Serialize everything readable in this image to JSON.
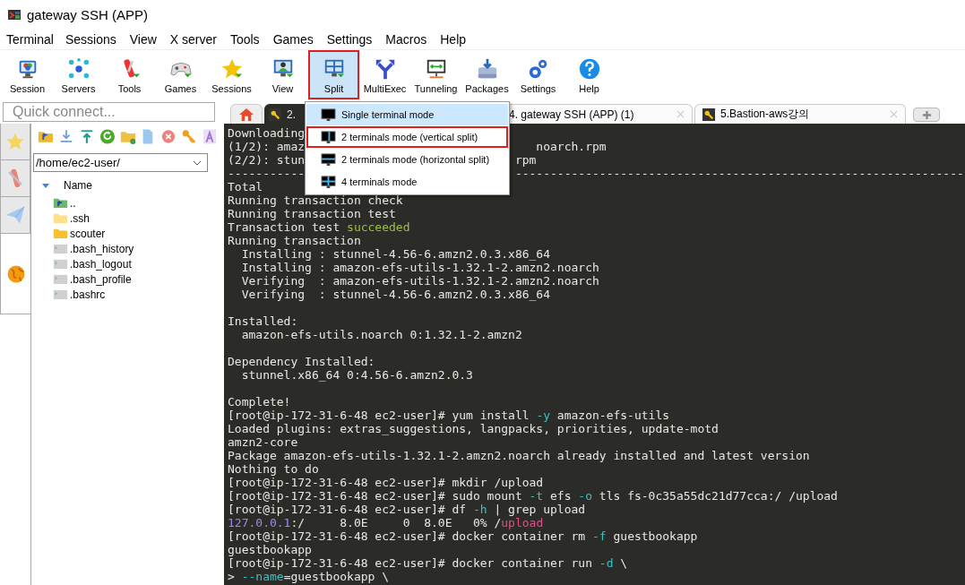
{
  "window": {
    "title": "gateway SSH (APP)"
  },
  "menu_bar": [
    "Terminal",
    "Sessions",
    "View",
    "X server",
    "Tools",
    "Games",
    "Settings",
    "Macros",
    "Help"
  ],
  "toolbar": [
    {
      "label": "Session",
      "selected": false,
      "outlined": false
    },
    {
      "label": "Servers",
      "selected": false,
      "outlined": false
    },
    {
      "label": "Tools",
      "selected": false,
      "outlined": false
    },
    {
      "label": "Games",
      "selected": false,
      "outlined": false
    },
    {
      "label": "Sessions",
      "selected": false,
      "outlined": false
    },
    {
      "label": "View",
      "selected": false,
      "outlined": false
    },
    {
      "label": "Split",
      "selected": true,
      "outlined": true
    },
    {
      "label": "MultiExec",
      "selected": false,
      "outlined": false
    },
    {
      "label": "Tunneling",
      "selected": false,
      "outlined": false
    },
    {
      "label": "Packages",
      "selected": false,
      "outlined": false
    },
    {
      "label": "Settings",
      "selected": false,
      "outlined": false
    },
    {
      "label": "Help",
      "selected": false,
      "outlined": false
    }
  ],
  "quick_connect": {
    "placeholder": "Quick connect..."
  },
  "tabs": [
    {
      "label": "2.",
      "selected": true,
      "icon": true
    },
    {
      "label": "4. gateway SSH (APP) (1)",
      "selected": false,
      "icon": false
    },
    {
      "label": "5.Bastion-aws강의",
      "selected": false,
      "icon": true
    }
  ],
  "split_menu": [
    {
      "label": "Single terminal mode",
      "selected": true,
      "outlined": false
    },
    {
      "label": "2 terminals mode (vertical split)",
      "selected": false,
      "outlined": true
    },
    {
      "label": "2 terminals mode (horizontal split)",
      "selected": false,
      "outlined": false
    },
    {
      "label": "4 terminals mode",
      "selected": false,
      "outlined": false
    }
  ],
  "side_tabs": [
    {
      "selected": false
    },
    {
      "selected": false
    },
    {
      "selected": false
    },
    {
      "selected": true
    }
  ],
  "file_browser": {
    "path": "/home/ec2-user/",
    "column": "Name",
    "files": [
      {
        "name": "..",
        "kind": "up"
      },
      {
        "name": ".ssh",
        "kind": "hidden-folder"
      },
      {
        "name": "scouter",
        "kind": "folder"
      },
      {
        "name": ".bash_history",
        "kind": "file"
      },
      {
        "name": ".bash_logout",
        "kind": "file"
      },
      {
        "name": ".bash_profile",
        "kind": "file"
      },
      {
        "name": ".bashrc",
        "kind": "file"
      }
    ]
  },
  "terminal": [
    {
      "spans": [
        {
          "text": "Downloading"
        }
      ]
    },
    {
      "kind": "covered",
      "spans": [
        {
          "text": "(1/2): amaz"
        },
        {
          "text": "   noarch.rpm"
        }
      ]
    },
    {
      "kind": "covered",
      "spans": [
        {
          "text": "(2/2): stun"
        },
        {
          "text": "rpm"
        }
      ]
    },
    {
      "kind": "covered",
      "spans": [
        {
          "text": "-----------"
        },
        {
          "text": "----------------------------------------------------------------"
        }
      ]
    },
    {
      "spans": [
        {
          "text": "Total"
        }
      ]
    },
    {
      "spans": [
        {
          "text": "Running transaction check"
        }
      ]
    },
    {
      "spans": [
        {
          "text": "Running transaction test"
        }
      ]
    },
    {
      "spans": [
        {
          "text": "Transaction test "
        },
        {
          "text": "succeeded",
          "kind": "ok"
        }
      ]
    },
    {
      "spans": [
        {
          "text": "Running transaction"
        }
      ]
    },
    {
      "spans": [
        {
          "text": "  Installing : stunnel-4.56-6.amzn2.0.3.x86_64"
        }
      ]
    },
    {
      "spans": [
        {
          "text": "  Installing : amazon-efs-utils-1.32.1-2.amzn2.noarch"
        }
      ]
    },
    {
      "spans": [
        {
          "text": "  Verifying  : amazon-efs-utils-1.32.1-2.amzn2.noarch"
        }
      ]
    },
    {
      "spans": [
        {
          "text": "  Verifying  : stunnel-4.56-6.amzn2.0.3.x86_64"
        }
      ]
    },
    {
      "kind": "blank"
    },
    {
      "spans": [
        {
          "text": "Installed:"
        }
      ]
    },
    {
      "spans": [
        {
          "text": "  amazon-efs-utils.noarch 0:1.32.1-2.amzn2"
        }
      ]
    },
    {
      "kind": "blank"
    },
    {
      "spans": [
        {
          "text": "Dependency Installed:"
        }
      ]
    },
    {
      "spans": [
        {
          "text": "  stunnel.x86_64 0:4.56-6.amzn2.0.3"
        }
      ]
    },
    {
      "kind": "blank"
    },
    {
      "spans": [
        {
          "text": "Complete!"
        }
      ]
    },
    {
      "spans": [
        {
          "text": "[root@ip-172-31-6-48 ec2-user]# yum install "
        },
        {
          "text": "-y",
          "kind": "flag"
        },
        {
          "text": " amazon-efs-utils"
        }
      ]
    },
    {
      "spans": [
        {
          "text": "Loaded plugins: extras_suggestions, langpacks, priorities, update-motd"
        }
      ]
    },
    {
      "spans": [
        {
          "text": "amzn2-core"
        }
      ]
    },
    {
      "spans": [
        {
          "text": "Package amazon-efs-utils-1.32.1-2.amzn2.noarch already installed and latest version"
        }
      ]
    },
    {
      "spans": [
        {
          "text": "Nothing to do"
        }
      ]
    },
    {
      "spans": [
        {
          "text": "[root@ip-172-31-6-48 ec2-user]# mkdir /upload"
        }
      ]
    },
    {
      "spans": [
        {
          "text": "[root@ip-172-31-6-48 ec2-user]# sudo mount "
        },
        {
          "text": "-t",
          "kind": "flag"
        },
        {
          "text": " efs "
        },
        {
          "text": "-o",
          "kind": "flag"
        },
        {
          "text": " tls fs-0c35a55dc21d77cca:/ /upload"
        }
      ]
    },
    {
      "spans": [
        {
          "text": "[root@ip-172-31-6-48 ec2-user]# df "
        },
        {
          "text": "-h",
          "kind": "flag"
        },
        {
          "text": " | grep upload"
        }
      ]
    },
    {
      "spans": [
        {
          "text": "127.0.0.1",
          "kind": "address"
        },
        {
          "text": ":/     8.0E     0  8.0E   0% /"
        },
        {
          "text": "upload",
          "kind": "match"
        }
      ]
    },
    {
      "spans": [
        {
          "text": "[root@ip-172-31-6-48 ec2-user]# docker container rm "
        },
        {
          "text": "-f",
          "kind": "flag"
        },
        {
          "text": " guestbookapp"
        }
      ]
    },
    {
      "spans": [
        {
          "text": "guestbookapp"
        }
      ]
    },
    {
      "spans": [
        {
          "text": "[root@ip-172-31-6-48 ec2-user]# docker container run "
        },
        {
          "text": "-d",
          "kind": "flag"
        },
        {
          "text": " \\"
        }
      ]
    },
    {
      "spans": [
        {
          "text": "> "
        },
        {
          "text": "--name",
          "kind": "flag"
        },
        {
          "text": "=guestbookapp \\"
        }
      ]
    }
  ]
}
